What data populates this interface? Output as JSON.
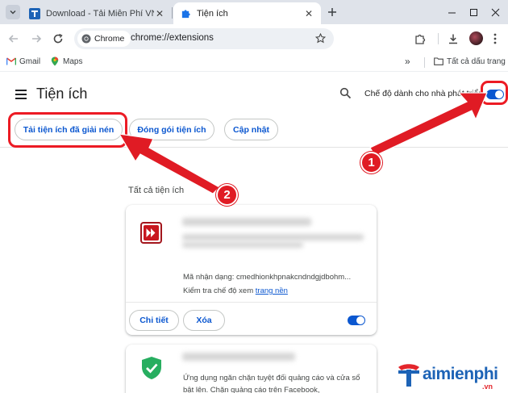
{
  "tabs": [
    {
      "title": "Download - Tải Miễn Phí VN - Ph",
      "active": false
    },
    {
      "title": "Tiện ích",
      "active": true
    }
  ],
  "toolbar": {
    "chip_label": "Chrome",
    "url": "chrome://extensions"
  },
  "bookmarks": {
    "items": [
      "Gmail",
      "Maps"
    ],
    "overflow": "»",
    "all_bookmarks": "Tất cả dấu trang"
  },
  "page": {
    "title": "Tiện ích",
    "dev_mode_label": "Chế độ dành cho nhà phát triển",
    "dev_mode_on": true,
    "actions": [
      "Tải tiện ích đã giải nén",
      "Đóng gói tiện ích",
      "Cập nhật"
    ],
    "section_title": "Tất cả tiện ích"
  },
  "extensions": [
    {
      "icon": "red-double-arrow-icon",
      "id_text": "Mã nhận dạng: cmedhionkhpnakcndndgjdbohm...",
      "inspect_prefix": "Kiểm tra chế độ xem",
      "inspect_link": "trang nền",
      "details_label": "Chi tiết",
      "remove_label": "Xóa",
      "enabled": true
    },
    {
      "icon": "green-shield-icon",
      "description": "Ứng dụng ngăn chặn tuyệt đối quảng cáo và cửa sổ bật lên. Chặn quảng cáo trên Facebook,"
    }
  ],
  "annotations": {
    "badge1": "1",
    "badge2": "2"
  },
  "watermark": {
    "text": "aimienphi",
    "suffix": ".vn"
  },
  "colors": {
    "accent": "#0b57d0",
    "annotation_red": "#e01b24",
    "tabstrip": "#dfe3ea"
  }
}
